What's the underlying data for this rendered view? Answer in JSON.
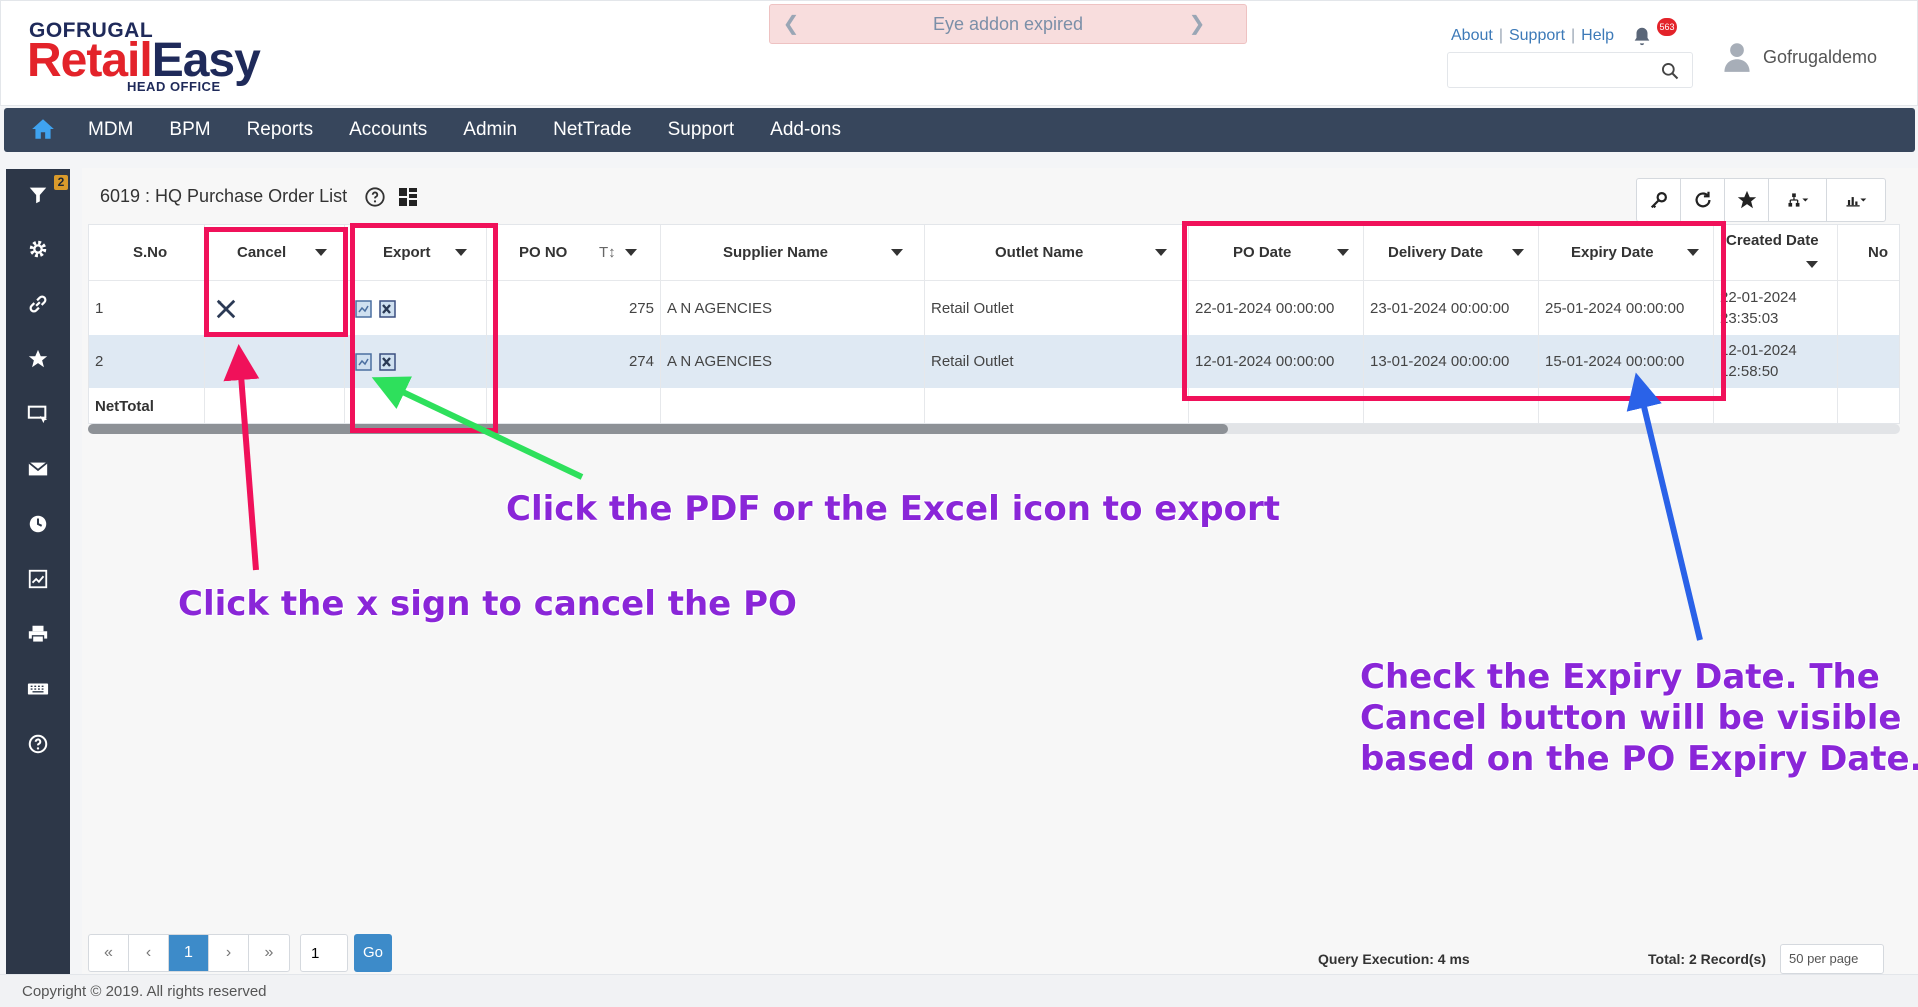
{
  "header": {
    "brand_top": "GOFRUGAL",
    "brand_main_1": "Retail",
    "brand_main_2": "Easy",
    "brand_sub": "HEAD OFFICE",
    "banner_text": "Eye addon expired",
    "links": {
      "about": "About",
      "support": "Support",
      "help": "Help"
    },
    "notification_count": "563",
    "search": {
      "placeholder": "",
      "value": ""
    },
    "user_name": "Gofrugaldemo"
  },
  "nav": {
    "items": [
      "MDM",
      "BPM",
      "Reports",
      "Accounts",
      "Admin",
      "NetTrade",
      "Support",
      "Add-ons"
    ]
  },
  "sidebar": {
    "filter_badge": "2",
    "icons": [
      "filter-icon",
      "gear-icon",
      "link-icon",
      "star-icon",
      "screen-icon",
      "mail-icon",
      "clock-icon",
      "chart-icon",
      "print-icon",
      "keyboard-icon",
      "help-icon"
    ]
  },
  "page": {
    "title": "6019 : HQ Purchase Order List"
  },
  "table": {
    "columns": {
      "sno": "S.No",
      "cancel": "Cancel",
      "export": "Export",
      "pono": "PO NO",
      "supplier": "Supplier Name",
      "outlet": "Outlet Name",
      "podate": "PO Date",
      "delivery": "Delivery Date",
      "expiry": "Expiry Date",
      "created": "Created Date",
      "next": "No"
    },
    "rows": [
      {
        "sno": "1",
        "pono": "275",
        "supplier": "A N AGENCIES",
        "outlet": "Retail Outlet",
        "podate": "22-01-2024 00:00:00",
        "delivery": "23-01-2024 00:00:00",
        "expiry": "25-01-2024 00:00:00",
        "created_date": "22-01-2024",
        "created_time": "23:35:03"
      },
      {
        "sno": "2",
        "pono": "274",
        "supplier": "A N AGENCIES",
        "outlet": "Retail Outlet",
        "podate": "12-01-2024 00:00:00",
        "delivery": "13-01-2024 00:00:00",
        "expiry": "15-01-2024 00:00:00",
        "created_date": "12-01-2024",
        "created_time": "12:58:50"
      }
    ],
    "net_total": "NetTotal"
  },
  "pager": {
    "first": "«",
    "prev": "‹",
    "current": "1",
    "next": "›",
    "last": "»",
    "page_input": "1",
    "go": "Go",
    "query_exec": "Query Execution: 4 ms",
    "total": "Total: 2 Record(s)",
    "per_page": "50 per page"
  },
  "footer": {
    "copyright": "Copyright © 2019. All rights reserved"
  },
  "annotations": {
    "export_note": "Click the PDF or the Excel icon to export",
    "cancel_note": "Click the x sign to cancel the PO",
    "expiry_note_1": "Check the Expiry Date. The",
    "expiry_note_2": "Cancel button will be visible",
    "expiry_note_3": "based on the PO Expiry Date.",
    "colors": {
      "box": "#f0115a",
      "text": "#8a26d8",
      "arrow_red": "#f0115a",
      "arrow_green": "#2ee05c",
      "arrow_blue": "#2a62e8"
    }
  }
}
